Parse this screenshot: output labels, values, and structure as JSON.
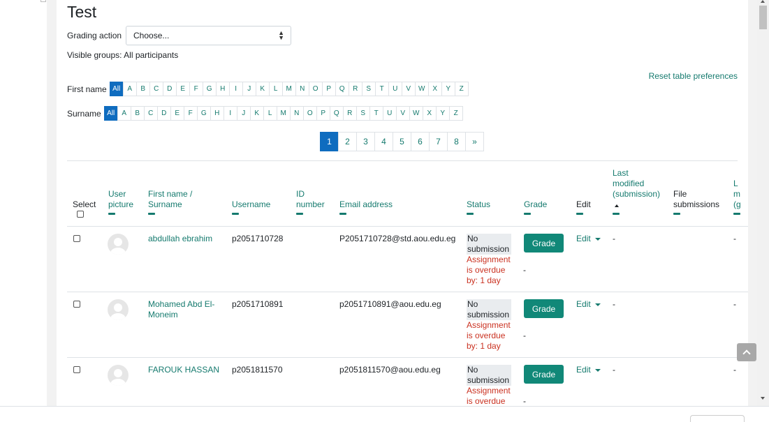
{
  "page": {
    "title": "Test",
    "grading_action_label": "Grading action",
    "grading_action_value": "Choose...",
    "visible_groups": "Visible groups: All participants",
    "reset_table_preferences": "Reset table preferences"
  },
  "initials": {
    "firstname_label": "First name",
    "surname_label": "Surname",
    "all_label": "All",
    "letters": [
      "A",
      "B",
      "C",
      "D",
      "E",
      "F",
      "G",
      "H",
      "I",
      "J",
      "K",
      "L",
      "M",
      "N",
      "O",
      "P",
      "Q",
      "R",
      "S",
      "T",
      "U",
      "V",
      "W",
      "X",
      "Y",
      "Z"
    ]
  },
  "pagination": {
    "pages": [
      "1",
      "2",
      "3",
      "4",
      "5",
      "6",
      "7",
      "8"
    ],
    "next": "»",
    "current": "1"
  },
  "table": {
    "headers": {
      "select": "Select",
      "user_picture_1": "User",
      "user_picture_2": "picture",
      "name_1": "First name /",
      "name_2": "Surname",
      "username": "Username",
      "idnumber_1": "ID",
      "idnumber_2": "number",
      "email": "Email address",
      "status": "Status",
      "grade": "Grade",
      "edit": "Edit",
      "lastmod_1": "Last",
      "lastmod_2": "modified",
      "lastmod_3": "(submission)",
      "files_1": "File",
      "files_2": "submissions",
      "cut_1": "L",
      "cut_2": "m",
      "cut_3": "(g"
    },
    "rows": [
      {
        "name_line1": "abdullah ebrahim",
        "name_line2": "",
        "username": "p2051710728",
        "email": "P2051710728@std.aou.edu.eg",
        "status_1": "No",
        "status_2": "submission",
        "overdue_1": "Assignment",
        "overdue_2": "is overdue",
        "overdue_3": "by: 1 day",
        "grade_dash": "-",
        "grade_button": "Grade",
        "edit": "Edit",
        "last_modified": "-",
        "cut": "-"
      },
      {
        "name_line1": "Mohamed Abd El-",
        "name_line2": "Moneim",
        "username": "p2051710891",
        "email": "p2051710891@aou.edu.eg",
        "status_1": "No",
        "status_2": "submission",
        "overdue_1": "Assignment",
        "overdue_2": "is overdue",
        "overdue_3": "by: 1 day",
        "grade_dash": "-",
        "grade_button": "Grade",
        "edit": "Edit",
        "last_modified": "-",
        "cut": "-"
      },
      {
        "name_line1": "FAROUK HASSAN",
        "name_line2": "",
        "username": "p2051811570",
        "email": "p2051811570@aou.edu.eg",
        "status_1": "No",
        "status_2": "submission",
        "overdue_1": "Assignment",
        "overdue_2": "is overdue",
        "overdue_3": "",
        "grade_dash": "-",
        "grade_button": "Grade",
        "edit": "Edit",
        "last_modified": "-",
        "cut": "-"
      }
    ]
  },
  "colors": {
    "link": "#157a6e",
    "primary": "#0f6cbf",
    "grade_button": "#118878",
    "overdue": "#ca3120"
  },
  "icons": [
    "select-arrows-icon",
    "sort-up-icon",
    "caret-down-icon",
    "avatar-icon",
    "chevron-up-icon"
  ]
}
